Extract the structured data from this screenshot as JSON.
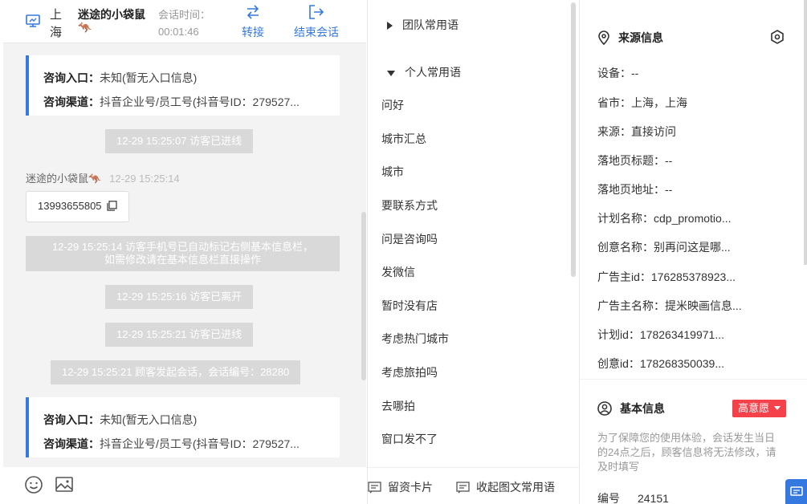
{
  "header": {
    "city": "上海",
    "visitor_name": "迷途的小袋鼠🦘",
    "time_label": "会话时间：",
    "time_value": "00:01:46",
    "transfer_label": "转接",
    "end_label": "结束会话"
  },
  "chat": {
    "entry_cards": [
      {
        "entry_label": "咨询入口：",
        "entry_value": "未知(暂无入口信息)",
        "channel_label": "咨询渠道：",
        "channel_value": "抖音企业号/员工号(抖音号ID：279527..."
      },
      {
        "entry_label": "咨询入口：",
        "entry_value": "未知(暂无入口信息)",
        "channel_label": "咨询渠道：",
        "channel_value": "抖音企业号/员工号(抖音号ID：279527..."
      }
    ],
    "sys_msgs": [
      "12-29 15:25:07 访客已进线",
      "12-29 15:25:14 访客手机号已自动标记右侧基本信息栏，",
      "如需修改请在基本信息栏直接操作",
      "12-29 15:25:16 访客已离开",
      "12-29 15:25:21 访客已进线",
      "12-29 15:25:21 顾客发起会话，会话编号：28280"
    ],
    "message": {
      "sender": "迷途的小袋鼠🦘",
      "time": "12-29 15:25:14",
      "text": "13993655805"
    }
  },
  "footer": {
    "emoji_icon": "smile-icon",
    "image_icon": "image-icon"
  },
  "phrases": {
    "team_group": "团队常用语",
    "personal_group": "个人常用语",
    "items": [
      "问好",
      "城市汇总",
      "城市",
      "要联系方式",
      "问是咨询吗",
      "发微信",
      "暂时没有店",
      "考虑热门城市",
      "考虑旅拍吗",
      "去哪拍",
      "窗口发不了"
    ],
    "card_button": "留资卡片",
    "collapse_button": "收起图文常用语"
  },
  "info": {
    "source_title": "来源信息",
    "rows": [
      "设备：--",
      "省市：上海，上海",
      "来源：直接访问",
      "落地页标题：--",
      "落地页地址：--",
      "计划名称：cdp_promotio...",
      "创意名称：别再问这是哪...",
      "广告主id：176285378923...",
      "广告主名称：提米映画信息...",
      "计划id：178263419971...",
      "创意id：178268350039..."
    ],
    "basic_title": "基本信息",
    "intention": "高意愿",
    "note": "为了保障您的使用体验，会话发生当日的24点之后，顾客信息将无法修改，请及时填写",
    "id_label": "编号",
    "id_value": "24151"
  },
  "colors": {
    "accent": "#3478e0",
    "danger": "#f5414a",
    "pill": "#d9d9d9"
  }
}
